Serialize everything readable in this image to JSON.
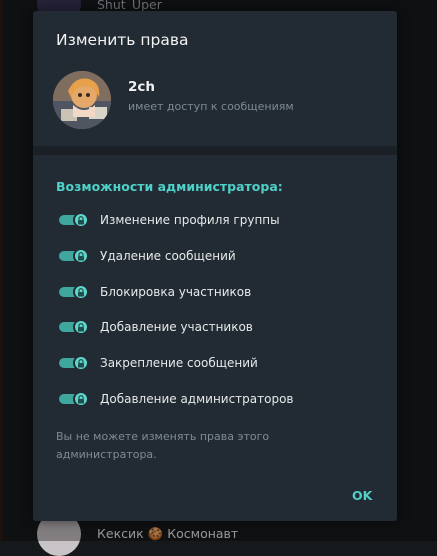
{
  "background": {
    "top_chat_name": "Shut_Uper",
    "bottom_chat_name_left": "Кексик",
    "bottom_chat_emoji": "🍪",
    "bottom_chat_name_right": "Космонавт"
  },
  "dialog": {
    "title": "Изменить права",
    "user": {
      "name": "2ch",
      "status": "имеет доступ к сообщениям"
    },
    "section_title": "Возможности администратора:",
    "permissions": [
      {
        "label": "Изменение профиля группы",
        "enabled": true,
        "locked": true
      },
      {
        "label": "Удаление сообщений",
        "enabled": true,
        "locked": true
      },
      {
        "label": "Блокировка участников",
        "enabled": true,
        "locked": true
      },
      {
        "label": "Добавление участников",
        "enabled": true,
        "locked": true
      },
      {
        "label": "Закрепление сообщений",
        "enabled": true,
        "locked": true
      },
      {
        "label": "Добавление администраторов",
        "enabled": true,
        "locked": true
      }
    ],
    "note": "Вы не можете изменять права этого администратора.",
    "ok_label": "OK"
  },
  "colors": {
    "accent": "#4fd0c8",
    "dialog_bg": "#222b33",
    "toggle_on": "#5fd6cc"
  }
}
